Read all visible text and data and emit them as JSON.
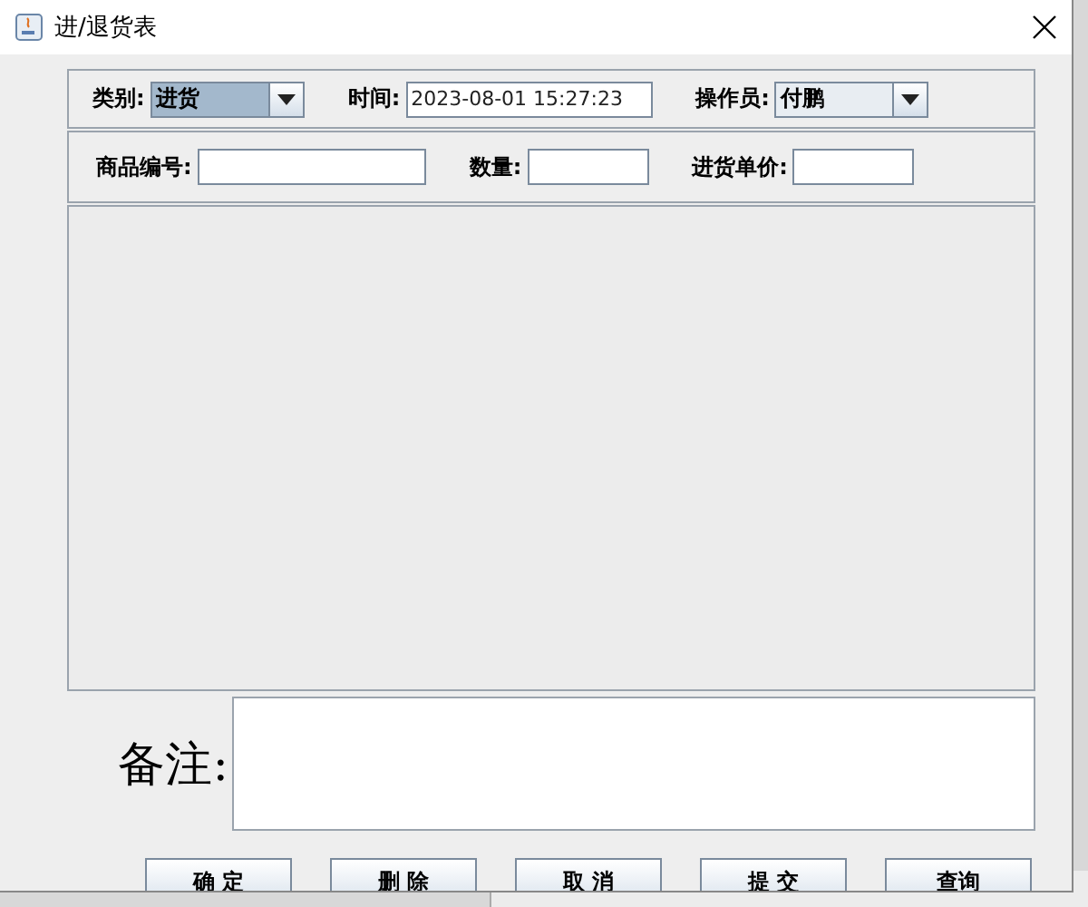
{
  "window": {
    "title": "进/退货表"
  },
  "row1": [
    {
      "kind": "select",
      "label": "类别:",
      "value": "进货",
      "selected": true
    },
    {
      "kind": "text",
      "label": "时间:",
      "value": "2023-08-01 15:27:23"
    },
    {
      "kind": "select",
      "label": "操作员:",
      "value": "付鹏",
      "selected": false
    }
  ],
  "row2": [
    {
      "kind": "text",
      "label": "商品编号:"
    },
    {
      "kind": "text",
      "label": "数量:"
    },
    {
      "kind": "text",
      "label": "进货单价:"
    }
  ],
  "remark": {
    "label": "备注:"
  },
  "buttons": [
    "确 定",
    "删 除",
    "取 消",
    "提 交",
    "查询"
  ]
}
